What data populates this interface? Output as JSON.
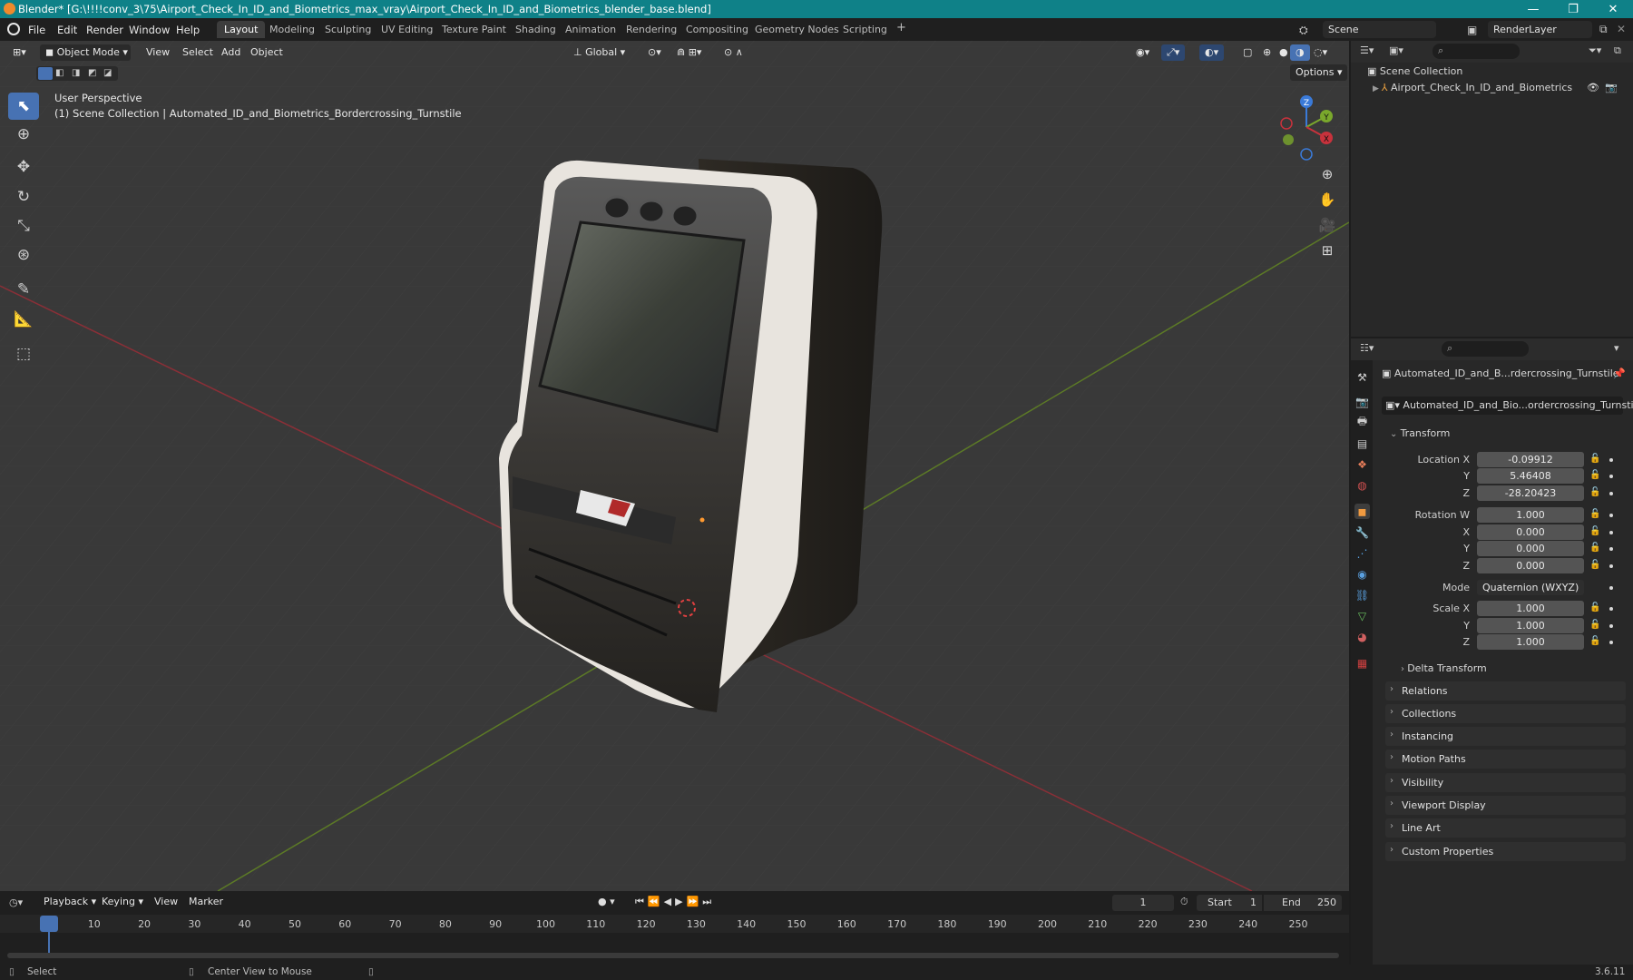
{
  "window": {
    "title": "Blender* [G:\\!!!!conv_3\\75\\Airport_Check_In_ID_and_Biometrics_max_vray\\Airport_Check_In_ID_and_Biometrics_blender_base.blend]",
    "minimize": "—",
    "maximize": "❐",
    "close": "✕"
  },
  "menu": [
    "File",
    "Edit",
    "Render",
    "Window",
    "Help"
  ],
  "workspaces": [
    "Layout",
    "Modeling",
    "Sculpting",
    "UV Editing",
    "Texture Paint",
    "Shading",
    "Animation",
    "Rendering",
    "Compositing",
    "Geometry Nodes",
    "Scripting"
  ],
  "active_workspace": "Layout",
  "add_workspace": "+",
  "scene": {
    "name": "Scene",
    "render_layer": "RenderLayer"
  },
  "viewport": {
    "mode": "Object Mode",
    "menus": [
      "View",
      "Select",
      "Add",
      "Object"
    ],
    "transform_orientation": "Global",
    "options": "Options",
    "overlay_line1": "User Perspective",
    "overlay_line2": "(1) Scene Collection | Automated_ID_and_Biometrics_Bordercrossing_Turnstile",
    "gizmo": {
      "x": "X",
      "y": "Y",
      "z": "Z"
    }
  },
  "outliner": {
    "root": "Scene Collection",
    "items": [
      {
        "label": "Airport_Check_In_ID_and_Biometrics"
      }
    ]
  },
  "properties": {
    "object_name_short": "Automated_ID_and_B...rdercrossing_Turnstile",
    "object_name_data": "Automated_ID_and_Bio...ordercrossing_Turnstile",
    "transform_header": "Transform",
    "location": {
      "label": "Location X",
      "x": "-0.09912",
      "y": "5.46408",
      "z": "-28.20423"
    },
    "rotation": {
      "label": "Rotation W",
      "w": "1.000",
      "x": "0.000",
      "y": "0.000",
      "z": "0.000"
    },
    "axis_labels": {
      "x": "X",
      "y": "Y",
      "z": "Z"
    },
    "mode": {
      "label": "Mode",
      "value": "Quaternion (WXYZ)"
    },
    "scale": {
      "label": "Scale X",
      "x": "1.000",
      "y": "1.000",
      "z": "1.000"
    },
    "delta_transform": "Delta Transform",
    "panels": [
      "Relations",
      "Collections",
      "Instancing",
      "Motion Paths",
      "Visibility",
      "Viewport Display",
      "Line Art",
      "Custom Properties"
    ]
  },
  "timeline": {
    "menus": [
      "Playback",
      "Keying",
      "View",
      "Marker"
    ],
    "current_frame": "1",
    "start_label": "Start",
    "start": "1",
    "end_label": "End",
    "end": "250",
    "ticks": [
      "1",
      "10",
      "20",
      "30",
      "40",
      "50",
      "60",
      "70",
      "80",
      "90",
      "100",
      "110",
      "120",
      "130",
      "140",
      "150",
      "160",
      "170",
      "180",
      "190",
      "200",
      "210",
      "220",
      "230",
      "240",
      "250"
    ]
  },
  "status": {
    "left": "Select",
    "middle": "Center View to Mouse",
    "version": "3.6.11"
  },
  "colors": {
    "accent": "#4772b3",
    "titlebar": "#0f8188",
    "x_axis": "#c8323c",
    "y_axis": "#7aa82c",
    "z_axis": "#3a7ad8"
  }
}
